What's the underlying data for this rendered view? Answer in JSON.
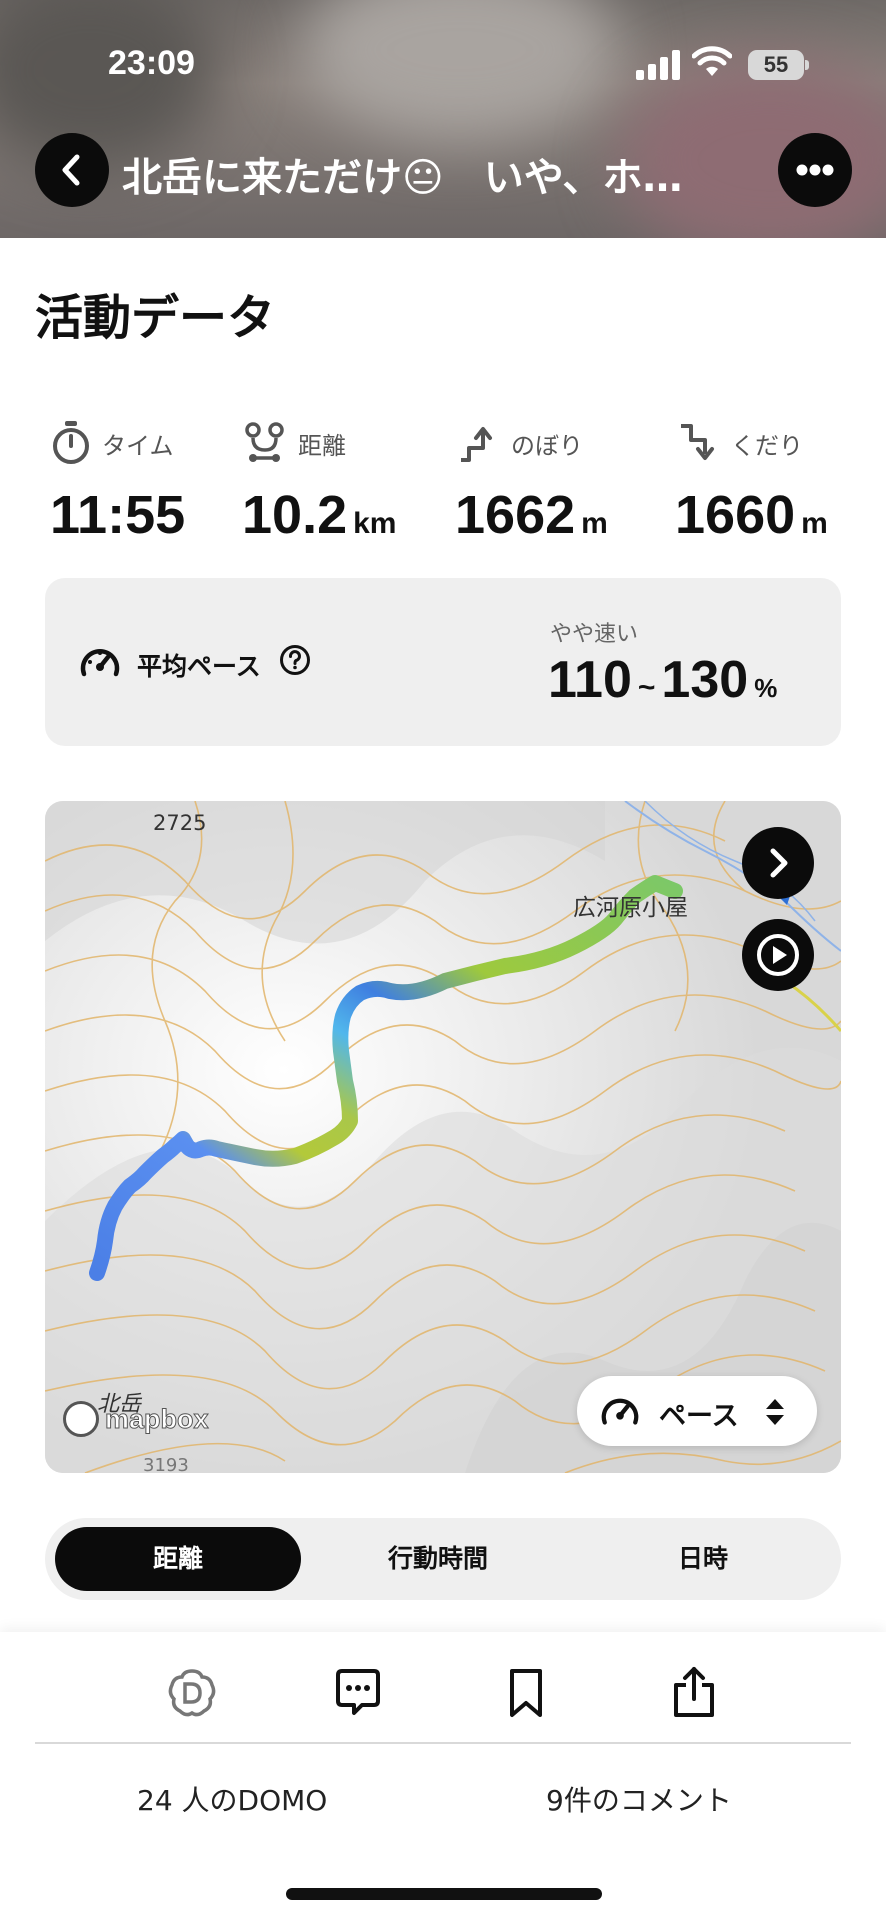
{
  "status_bar": {
    "time": "23:09",
    "battery": "55"
  },
  "nav": {
    "title": "北岳に来ただけ😐　いや、ホ…"
  },
  "activity": {
    "section_title": "活動データ",
    "stats": [
      {
        "label": "タイム",
        "value": "11:55",
        "unit": "",
        "icon": "stopwatch-icon"
      },
      {
        "label": "距離",
        "value": "10.2",
        "unit": "km",
        "icon": "route-icon"
      },
      {
        "label": "のぼり",
        "value": "1662",
        "unit": "m",
        "icon": "ascent-icon"
      },
      {
        "label": "くだり",
        "value": "1660",
        "unit": "m",
        "icon": "descent-icon"
      }
    ]
  },
  "pace": {
    "label": "平均ペース",
    "sub_label": "やや速い",
    "min": "110",
    "sep": "~",
    "max": "130",
    "unit": "%"
  },
  "map": {
    "labels": {
      "peak_top": "2725",
      "hut": "広河原小屋",
      "start": "北岳",
      "bottom_elev": "3193"
    },
    "attribution": "mapbox",
    "pace_toggle": "ペース"
  },
  "segments": {
    "items": [
      "距離",
      "行動時間",
      "日時"
    ],
    "active_index": 0
  },
  "bottom": {
    "domo": "24 人のDOMO",
    "comments": "9件のコメント"
  },
  "colors": {
    "accent": "#0b0b0b",
    "route_blue": "#3f7fe0",
    "route_green": "#a8c83b",
    "contour": "#e2b56a"
  }
}
